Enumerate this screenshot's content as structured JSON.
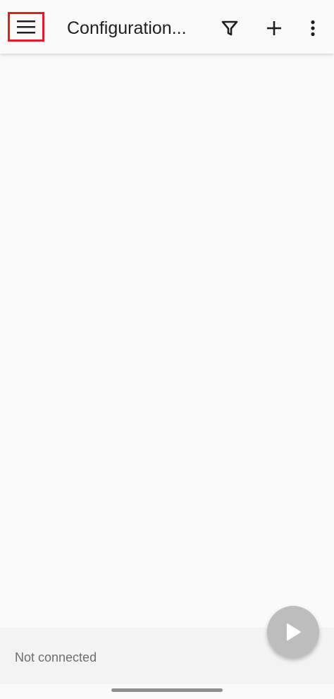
{
  "app_bar": {
    "title": "Configuration..."
  },
  "icons": {
    "menu": "menu-icon",
    "filter": "filter-icon",
    "add": "add-icon",
    "more": "more-vert-icon",
    "play": "play-icon"
  },
  "status": {
    "text": "Not connected"
  },
  "colors": {
    "highlight": "#e01e25",
    "fab": "#bdbdbd",
    "background": "#fafafa"
  }
}
